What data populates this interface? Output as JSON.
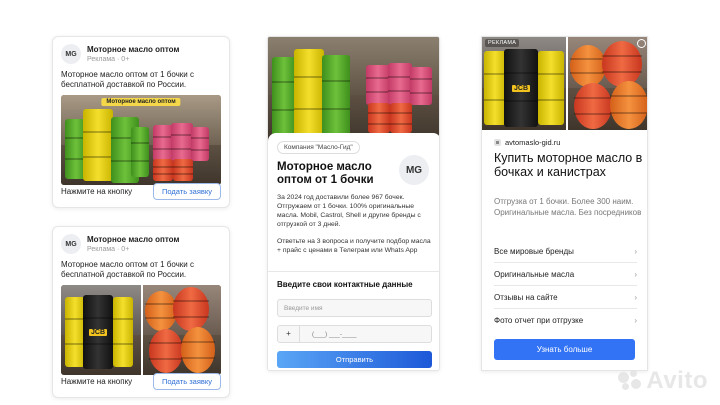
{
  "ad_card_1": {
    "avatar": "MG",
    "title": "Моторное масло оптом",
    "subtitle": "Реклама · 0+",
    "body": "Моторное масло оптом от 1 бочки с бесплатной доставкой по России.",
    "image_label": "Моторное масло оптом",
    "footer_text": "Нажмите на кнопку",
    "button": "Подать заявку"
  },
  "ad_card_2": {
    "avatar": "MG",
    "title": "Моторное масло оптом",
    "subtitle": "Реклама · 0+",
    "body": "Моторное масло оптом от 1 бочки с бесплатной доставкой по России.",
    "footer_text": "Нажмите на кнопку",
    "button": "Подать заявку"
  },
  "mobile_card": {
    "company": "Компания \"Масло-Гид\"",
    "title": "Моторное масло оптом от 1 бочки",
    "avatar": "MG",
    "text1": "За 2024 год доставили более 967 бочек. Отгружаем от 1 бочки. 100% оригинальные масла. Mobil, Castrol, Shell и другие бренды с отгрузкой от 3 дней.",
    "text2": "Ответьте на 3 вопроса и получите подбор масла + прайс с ценами в Телеграм или Whats App",
    "form_title": "Введите свои контактные данные",
    "name_placeholder": "Введите имя",
    "phone_prefix": "+",
    "phone_mask": "(___) ___-____",
    "submit": "Отправить"
  },
  "yandex_card": {
    "ad_badge": "РЕКЛАМА",
    "site": "avtomaslo-gid.ru",
    "title": "Купить моторное масло в бочках и канистрах",
    "description": "Отгрузка от 1 бочки. Более 300 наим. Оригинальные масла. Без посредников",
    "items": [
      {
        "label": "Все мировые бренды"
      },
      {
        "label": "Оригинальные масла"
      },
      {
        "label": "Отзывы на сайте"
      },
      {
        "label": "Фото отчет при отгрузке"
      }
    ],
    "button": "Узнать больше"
  },
  "watermark": "Avito",
  "icons": {
    "chevron": "chevron-right-icon",
    "gear": "gear-icon",
    "site": "site-favicon-icon"
  }
}
